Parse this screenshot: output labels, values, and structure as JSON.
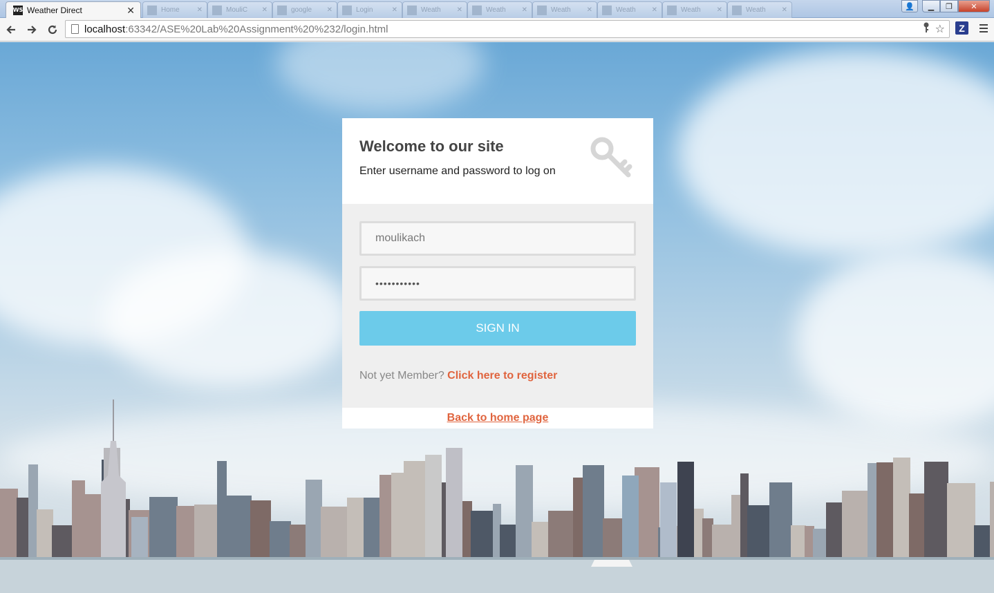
{
  "browser": {
    "active_tab_title": "Weather Direct",
    "active_tab_favicon": "WS",
    "inactive_tabs": [
      "Home",
      "MouliC",
      "google",
      "Login",
      "Weath",
      "Weath",
      "Weath",
      "Weath",
      "Weath",
      "Weath"
    ],
    "url_host": "localhost",
    "url_rest": ":63342/ASE%20Lab%20Assignment%20%232/login.html",
    "icons": [
      "back-icon",
      "forward-icon",
      "reload-icon",
      "page-icon",
      "key-icon",
      "star-icon",
      "z-extension-icon",
      "menu-icon"
    ]
  },
  "login": {
    "title": "Welcome to our site",
    "subtitle": "Enter username and password to log on",
    "username_value": "moulikach",
    "password_value": "•••••••••••",
    "signin_label": "SIGN IN",
    "member_prompt": "Not yet Member?",
    "register_link": "Click here to register",
    "home_link": "Back to home page"
  },
  "colors": {
    "accent_button": "#6ccbea",
    "link": "#e0643e",
    "card_body": "#efefef"
  }
}
